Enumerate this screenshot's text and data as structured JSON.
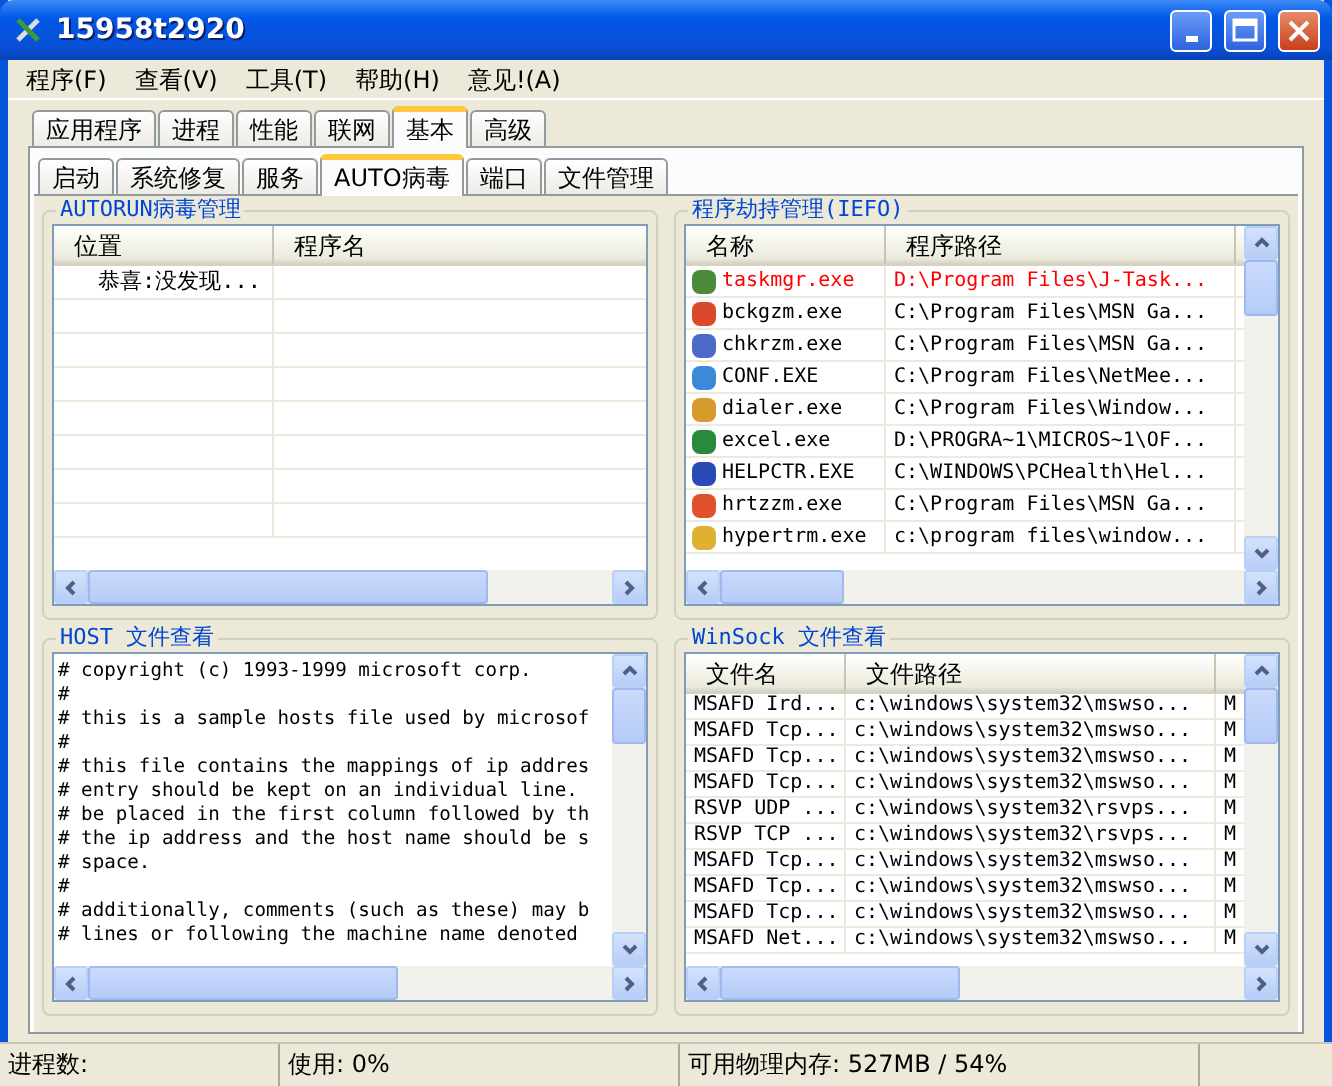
{
  "window": {
    "title": "15958t2920"
  },
  "menu": [
    {
      "label": "程序(F)"
    },
    {
      "label": "查看(V)"
    },
    {
      "label": "工具(T)"
    },
    {
      "label": "帮助(H)"
    },
    {
      "label": "意见!(A)"
    }
  ],
  "tabs": [
    {
      "label": "应用程序",
      "selected": false
    },
    {
      "label": "进程",
      "selected": false
    },
    {
      "label": "性能",
      "selected": false
    },
    {
      "label": "联网",
      "selected": false
    },
    {
      "label": "基本",
      "selected": true
    },
    {
      "label": "高级",
      "selected": false
    }
  ],
  "subtabs": [
    {
      "label": "启动",
      "selected": false
    },
    {
      "label": "系统修复",
      "selected": false
    },
    {
      "label": "服务",
      "selected": false
    },
    {
      "label": "AUTO病毒",
      "selected": true
    },
    {
      "label": "端口",
      "selected": false
    },
    {
      "label": "文件管理",
      "selected": false
    }
  ],
  "autorun": {
    "title": "AUTORUN病毒管理",
    "columns": [
      "位置",
      "程序名"
    ],
    "rows": [
      {
        "location": "恭喜:没发现..."
      }
    ]
  },
  "ifeo": {
    "title": "程序劫持管理(IEFO)",
    "columns": [
      "名称",
      "程序路径"
    ],
    "rows": [
      {
        "name": "taskmgr.exe",
        "path": "D:\\Program Files\\J-Task...",
        "flagged": true,
        "color": "#4a8a3a"
      },
      {
        "name": "bckgzm.exe",
        "path": "C:\\Program Files\\MSN Ga...",
        "flagged": false,
        "color": "#d84a2a"
      },
      {
        "name": "chkrzm.exe",
        "path": "C:\\Program Files\\MSN Ga...",
        "flagged": false,
        "color": "#4a6ac8"
      },
      {
        "name": "CONF.EXE",
        "path": "C:\\Program Files\\NetMee...",
        "flagged": false,
        "color": "#3a8ad8"
      },
      {
        "name": "dialer.exe",
        "path": "C:\\Program Files\\Window...",
        "flagged": false,
        "color": "#d89a2a"
      },
      {
        "name": "excel.exe",
        "path": "D:\\PROGRA~1\\MICROS~1\\OF...",
        "flagged": false,
        "color": "#2a8a3a"
      },
      {
        "name": "HELPCTR.EXE",
        "path": "C:\\WINDOWS\\PCHealth\\Hel...",
        "flagged": false,
        "color": "#2a4ab8"
      },
      {
        "name": "hrtzzm.exe",
        "path": "C:\\Program Files\\MSN Ga...",
        "flagged": false,
        "color": "#e0502a"
      },
      {
        "name": "hypertrm.exe",
        "path": "c:\\program files\\window...",
        "flagged": false,
        "color": "#e0b030"
      }
    ]
  },
  "hosts": {
    "title": "HOST 文件查看",
    "lines": [
      "# copyright (c) 1993-1999 microsoft corp.",
      "#",
      "# this is a sample hosts file used by microsof",
      "#",
      "# this file contains the mappings of ip addres",
      "# entry should be kept on an individual line.",
      "# be placed in the first column followed by th",
      "# the ip address and the host name should be s",
      "# space.",
      "#",
      "# additionally, comments (such as these) may b",
      "# lines or following the machine name denoted"
    ]
  },
  "winsock": {
    "title": "WinSock 文件查看",
    "columns": [
      "文件名",
      "文件路径"
    ],
    "rows": [
      {
        "name": "MSAFD Ird...",
        "path": "c:\\windows\\system32\\mswso...",
        "column_3": "M"
      },
      {
        "name": "MSAFD Tcp...",
        "path": "c:\\windows\\system32\\mswso...",
        "column_3": "M"
      },
      {
        "name": "MSAFD Tcp...",
        "path": "c:\\windows\\system32\\mswso...",
        "column_3": "M"
      },
      {
        "name": "MSAFD Tcp...",
        "path": "c:\\windows\\system32\\mswso...",
        "column_3": "M"
      },
      {
        "name": "RSVP UDP ...",
        "path": "c:\\windows\\system32\\rsvps...",
        "column_3": "M"
      },
      {
        "name": "RSVP TCP ...",
        "path": "c:\\windows\\system32\\rsvps...",
        "column_3": "M"
      },
      {
        "name": "MSAFD Tcp...",
        "path": "c:\\windows\\system32\\mswso...",
        "column_3": "M"
      },
      {
        "name": "MSAFD Tcp...",
        "path": "c:\\windows\\system32\\mswso...",
        "column_3": "M"
      },
      {
        "name": "MSAFD Tcp...",
        "path": "c:\\windows\\system32\\mswso...",
        "column_3": "M"
      },
      {
        "name": "MSAFD Net...",
        "path": "c:\\windows\\system32\\mswso...",
        "column_3": "M"
      }
    ]
  },
  "status_bar": [
    "进程数:",
    "使用: 0%",
    "可用物理内存: 527MB / 54%"
  ]
}
